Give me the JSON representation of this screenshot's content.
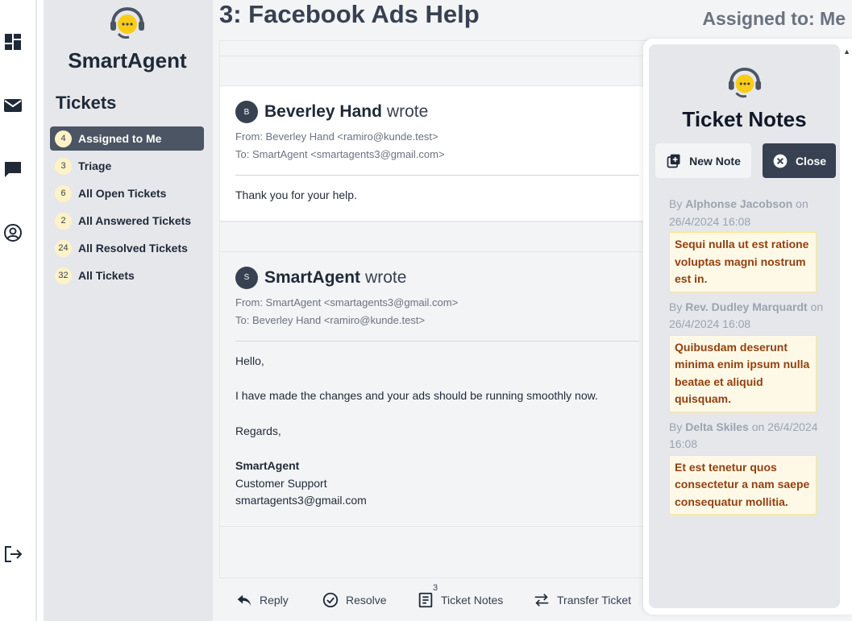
{
  "app": {
    "brand_name": "SmartAgent"
  },
  "sidebar": {
    "heading": "Tickets",
    "items": [
      {
        "count": "4",
        "label": "Assigned to Me",
        "active": true
      },
      {
        "count": "3",
        "label": "Triage",
        "active": false
      },
      {
        "count": "6",
        "label": "All Open Tickets",
        "active": false
      },
      {
        "count": "2",
        "label": "All Answered Tickets",
        "active": false
      },
      {
        "count": "24",
        "label": "All Resolved Tickets",
        "active": false
      },
      {
        "count": "32",
        "label": "All Tickets",
        "active": false
      }
    ]
  },
  "ticket": {
    "title": "3: Facebook Ads Help",
    "assigned": "Assigned to: Me"
  },
  "messages": [
    {
      "avatar_initial": "B",
      "author": "Beverley Hand",
      "wrote": "wrote",
      "from": "From: Beverley Hand <ramiro@kunde.test>",
      "to": "To: SmartAgent <smartagents3@gmail.com>",
      "body": "Thank you for your help."
    },
    {
      "avatar_initial": "S",
      "author": "SmartAgent",
      "wrote": "wrote",
      "from": "From: SmartAgent <smartagents3@gmail.com>",
      "to": "To: Beverley Hand <ramiro@kunde.test>",
      "greeting": "Hello,",
      "line": "I have made the changes and your ads should be running smoothly now.",
      "closing": "Regards,",
      "sig_name": "SmartAgent",
      "sig_role": "Customer Support",
      "sig_email": "smartagents3@gmail.com"
    }
  ],
  "actions": {
    "reply": "Reply",
    "resolve": "Resolve",
    "notes_count": "3",
    "notes": "Ticket Notes",
    "transfer": "Transfer Ticket"
  },
  "notes_panel": {
    "title": "Ticket Notes",
    "new_note": "New Note",
    "close": "Close",
    "notes": [
      {
        "by": "By",
        "author": "Alphonse Jacobson",
        "on": "on 26/4/2024 16:08",
        "text": "Sequi nulla ut est ratione voluptas magni nostrum est in."
      },
      {
        "by": "By",
        "author": "Rev. Dudley Marquardt",
        "on": "on 26/4/2024 16:08",
        "text": "Quibusdam deserunt minima enim ipsum nulla beatae et aliquid quisquam."
      },
      {
        "by": "By",
        "author": "Delta Skiles",
        "on": "on 26/4/2024 16:08",
        "text": "Et est tenetur quos consectetur a nam saepe consequatur mollitia."
      }
    ]
  },
  "colors": {
    "sidebar_bg": "#e5e7eb",
    "active_item": "#4b5563",
    "badge_bg": "#fef3c7",
    "note_bg": "#fef9e7",
    "note_text": "#92400e",
    "close_btn": "#374151"
  }
}
